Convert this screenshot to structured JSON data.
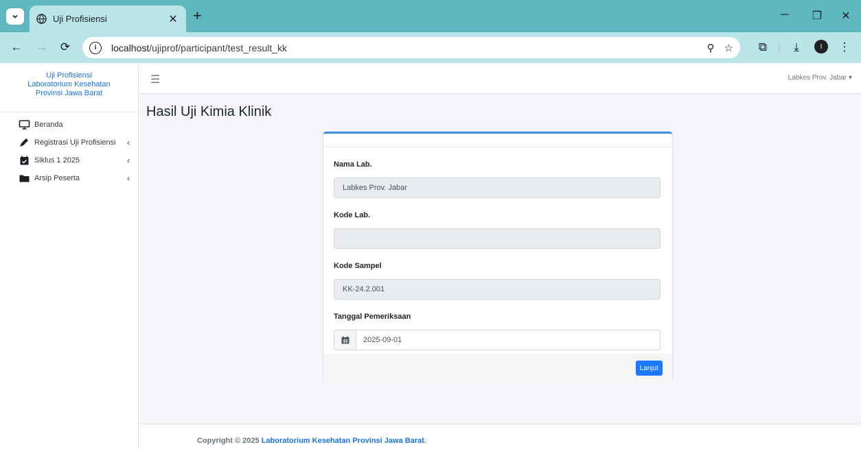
{
  "browser": {
    "tab_title": "Uji Profisiensi",
    "url_host": "localhost",
    "url_path": "/ujiprof/participant/test_result_kk",
    "profile_initial": "I"
  },
  "sidebar": {
    "brand_line1": "Uji Profisiensi",
    "brand_line2": "Laboratorium Kesehatan",
    "brand_line3": "Provinsi Jawa Barat",
    "items": [
      {
        "label": "Beranda",
        "icon": "monitor-icon"
      },
      {
        "label": "Registrasi Uji Profisiensi",
        "icon": "pen-icon"
      },
      {
        "label": "Siklus 1 2025",
        "icon": "calendar-check-icon"
      },
      {
        "label": "Arsip Peserta",
        "icon": "folder-icon"
      }
    ]
  },
  "navbar": {
    "user_label": "Labkes Prov. Jabar ▾"
  },
  "page": {
    "title": "Hasil Uji Kimia Klinik"
  },
  "form": {
    "nama_lab_label": "Nama Lab.",
    "nama_lab_value": "Labkes Prov. Jabar",
    "kode_lab_label": "Kode Lab.",
    "kode_lab_value": "",
    "kode_sampel_label": "Kode Sampel",
    "kode_sampel_value": "KK-24.2.001",
    "tanggal_label": "Tanggal Pemeriksaan",
    "tanggal_value": "2025-09-01",
    "submit_label": "Lanjut"
  },
  "footer": {
    "prefix": "Copyright © 2025 ",
    "org": "Laboratorium Kesehatan Provinsi Jawa Barat",
    "suffix": "."
  },
  "colors": {
    "chrome_titlebar": "#5fb8c0",
    "chrome_toolbar": "#b9e4e8",
    "accent": "#1a73e8",
    "button": "#1a7aff"
  }
}
